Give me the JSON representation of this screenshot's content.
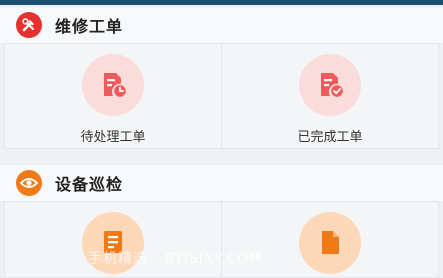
{
  "sections": [
    {
      "title": "维修工单",
      "icon": "wrench-hammer-icon",
      "icon_color": "#e8312f",
      "items": [
        {
          "label": "待处理工单",
          "icon": "pending-document-icon",
          "color": "#ef5a5a"
        },
        {
          "label": "已完成工单",
          "icon": "completed-document-icon",
          "color": "#ef5a5a"
        }
      ]
    },
    {
      "title": "设备巡检",
      "icon": "eye-icon",
      "icon_color": "#f07a17",
      "items": [
        {
          "label": "",
          "icon": "list-document-icon",
          "color": "#f07a17"
        },
        {
          "label": "",
          "icon": "file-icon",
          "color": "#f07a17"
        }
      ]
    }
  ],
  "watermark": "手机精选 · BYJSJXY.COM"
}
